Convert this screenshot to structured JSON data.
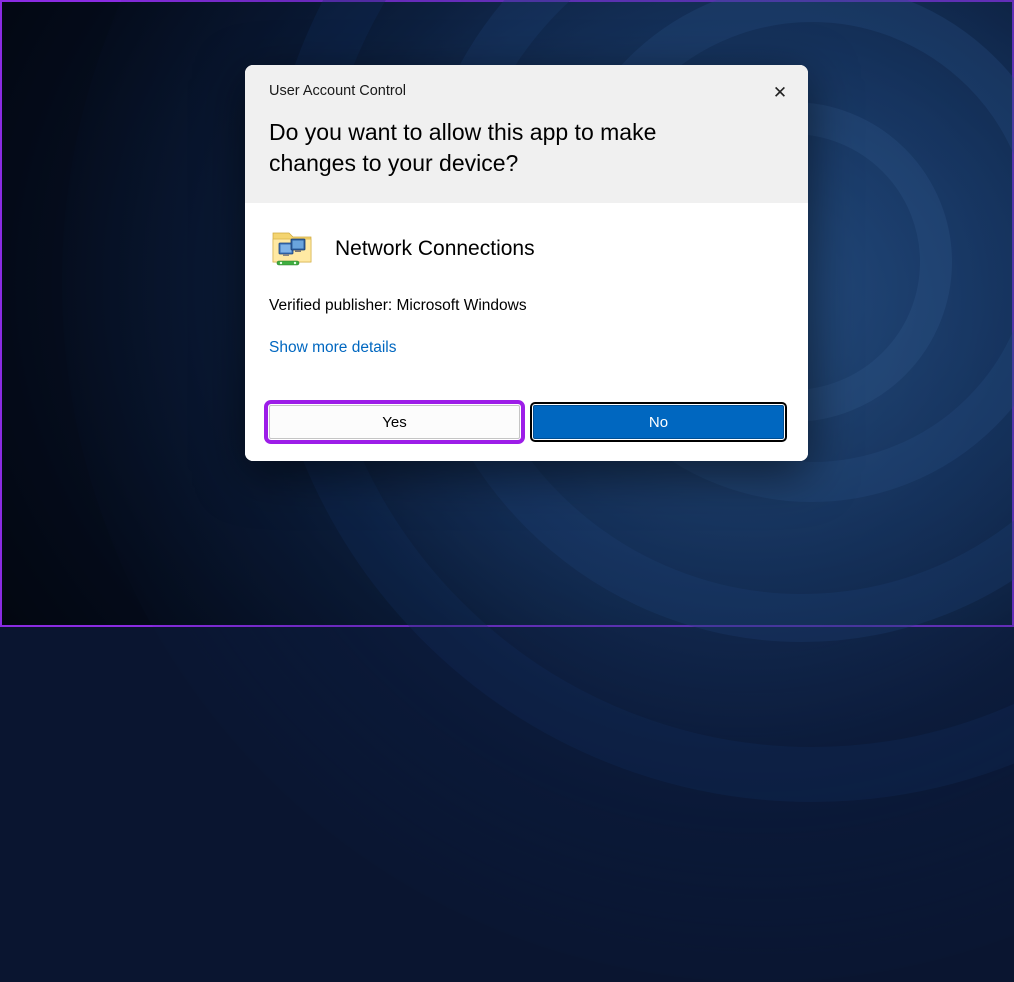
{
  "dialog": {
    "title_small": "User Account Control",
    "question": "Do you want to allow this app to make changes to your device?",
    "app_name": "Network Connections",
    "publisher_line": "Verified publisher: Microsoft Windows",
    "details_link": "Show more details",
    "yes_label": "Yes",
    "no_label": "No",
    "close_glyph": "✕"
  },
  "icons": {
    "app": "network-connections-icon",
    "close": "close-icon"
  },
  "colors": {
    "accent": "#0067c0",
    "highlight": "#9d1de8"
  }
}
